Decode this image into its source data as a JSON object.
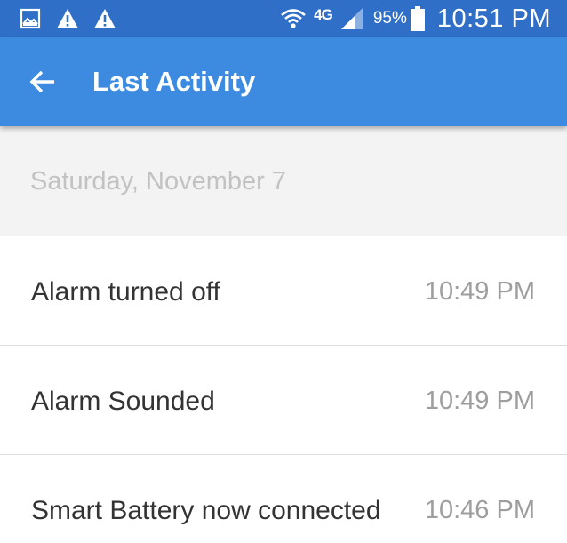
{
  "status_bar": {
    "left_icons": [
      "image-icon",
      "warning-icon",
      "warning-icon"
    ],
    "network": "4G",
    "battery_percent": "95%",
    "time": "10:51 PM"
  },
  "app_bar": {
    "title": "Last Activity",
    "color": "#3d8be0"
  },
  "date_header": "Saturday, November 7",
  "activities": [
    {
      "label": "Alarm turned off",
      "time": "10:49 PM"
    },
    {
      "label": "Alarm Sounded",
      "time": "10:49 PM"
    },
    {
      "label": "Smart Battery now connected",
      "time": "10:46 PM"
    }
  ]
}
